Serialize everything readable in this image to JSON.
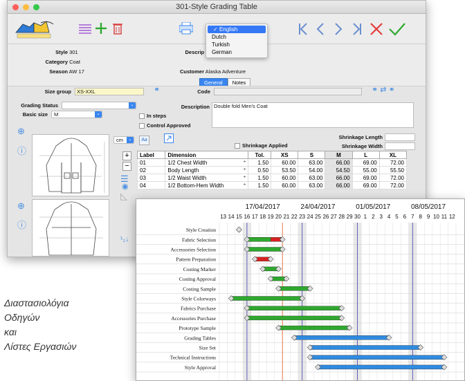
{
  "window": {
    "title": "301-Style Grading Table"
  },
  "languages": {
    "options": [
      "English",
      "Dutch",
      "Turkish",
      "German"
    ],
    "selected": "English"
  },
  "header": {
    "style_label": "Style",
    "style_value": "301",
    "category_label": "Category",
    "category_value": "Coat",
    "season_label": "Season",
    "season_value": "AW 17",
    "description_label": "Descrip",
    "customer_label": "Customer",
    "customer_value": "Alaska Adventure"
  },
  "tabs": [
    "General",
    "Notes"
  ],
  "form": {
    "size_group_label": "Size group",
    "size_group_value": "XS-XXL",
    "code_label": "Code",
    "grading_status_label": "Grading Status",
    "basic_size_label": "Basic size",
    "basic_size_value": "M",
    "description_label": "Description",
    "description_value": "Double fold Men's Coat",
    "in_steps_label": "In steps",
    "control_approved_label": "Control Approved",
    "unit_value": "cm",
    "aa_label": "Aa",
    "shrinkage_applied_label": "Shrinkage Applied",
    "shrinkage_length_label": "Shrinkage Length",
    "shrinkage_width_label": "Shrinkage Width"
  },
  "table": {
    "headers": [
      "Label",
      "Dimension",
      "Tol.",
      "XS",
      "S",
      "M",
      "L",
      "XL"
    ],
    "rows": [
      [
        "01",
        "1/2 Chest Width",
        "1.50",
        "60.00",
        "63.00",
        "66.00",
        "69.00",
        "72.00"
      ],
      [
        "02",
        "Body Length",
        "0.50",
        "53.50",
        "54.00",
        "54.50",
        "55.00",
        "55.50"
      ],
      [
        "03",
        "1/2 Waist Width",
        "1.50",
        "60.00",
        "63.00",
        "66.00",
        "69.00",
        "72.00"
      ],
      [
        "04",
        "1/2 Bottom-Hem Width",
        "1.50",
        "60.00",
        "63.00",
        "66.00",
        "69.00",
        "72.00"
      ]
    ]
  },
  "gantt": {
    "weeks": [
      "17/04/2017",
      "24/04/2017",
      "01/05/2017",
      "08/05/2017"
    ],
    "days": [
      "13",
      "14",
      "15",
      "16",
      "17",
      "18",
      "19",
      "20",
      "21",
      "22",
      "23",
      "24",
      "25",
      "26",
      "27",
      "28",
      "29",
      "30",
      "1",
      "2",
      "3",
      "4",
      "5",
      "6",
      "7",
      "8",
      "9",
      "10",
      "11",
      "12"
    ],
    "tasks": [
      {
        "name": "Style Creation",
        "start": 2.5,
        "end": 2.5,
        "color": "",
        "milestone": true
      },
      {
        "name": "Fabric Selection",
        "start": 3.5,
        "end": 8,
        "color": "#d82020",
        "split": 6.5
      },
      {
        "name": "Accessories Selection",
        "start": 3.5,
        "end": 8,
        "color": "#2ea82e"
      },
      {
        "name": "Pattern Preparation",
        "start": 4.5,
        "end": 6.5,
        "color": "#d82020"
      },
      {
        "name": "Costing Marker",
        "start": 5.5,
        "end": 7.5,
        "color": "#2ea82e"
      },
      {
        "name": "Costing Approval",
        "start": 6.5,
        "end": 8.5,
        "color": "#2ea82e"
      },
      {
        "name": "Costing Sample",
        "start": 7.5,
        "end": 11.5,
        "color": "#2ea82e"
      },
      {
        "name": "Style Colorways",
        "start": 1.5,
        "end": 10.5,
        "color": "#2ea82e"
      },
      {
        "name": "Fabrics Purchase",
        "start": 3.5,
        "end": 15.5,
        "color": "#2ea82e"
      },
      {
        "name": "Accessories Purchase",
        "start": 3.5,
        "end": 15.5,
        "color": "#2ea82e"
      },
      {
        "name": "Prototype Sample",
        "start": 7.5,
        "end": 16.5,
        "color": "#2ea82e"
      },
      {
        "name": "Grading Tables",
        "start": 9.5,
        "end": 21.5,
        "color": "#2f8be0"
      },
      {
        "name": "Size Set",
        "start": 11.5,
        "end": 25.5,
        "color": "#2f8be0"
      },
      {
        "name": "Technical Instructions",
        "start": 11.5,
        "end": 28.5,
        "color": "#2f8be0"
      },
      {
        "name": "Style Approval",
        "start": 12.5,
        "end": 28.5,
        "color": "#2f8be0"
      }
    ]
  },
  "caption": {
    "line1": "Διαστασιολόγια",
    "line2": "Οδηγών",
    "line3": "και",
    "line4": "Λίστες Εργασιών"
  }
}
